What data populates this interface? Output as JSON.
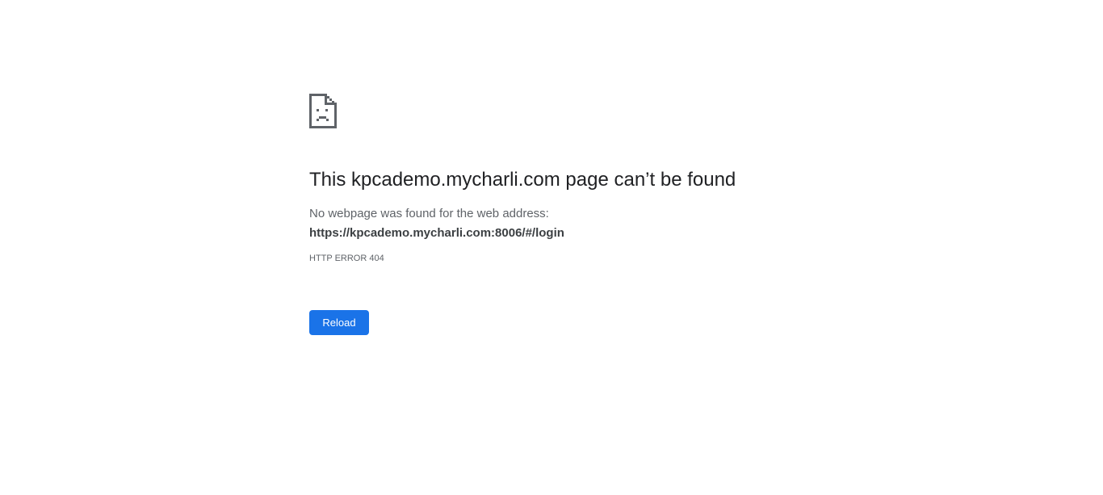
{
  "error": {
    "icon": "sad-page-icon",
    "title": "This kpcademo.mycharli.com page can’t be found",
    "message": "No webpage was found for the web address:",
    "url": "https://kpcademo.mycharli.com:8006/#/login",
    "code": "HTTP ERROR 404",
    "reload_label": "Reload"
  },
  "colors": {
    "title": "#202124",
    "text": "#5f6368",
    "button": "#1a73e8"
  }
}
